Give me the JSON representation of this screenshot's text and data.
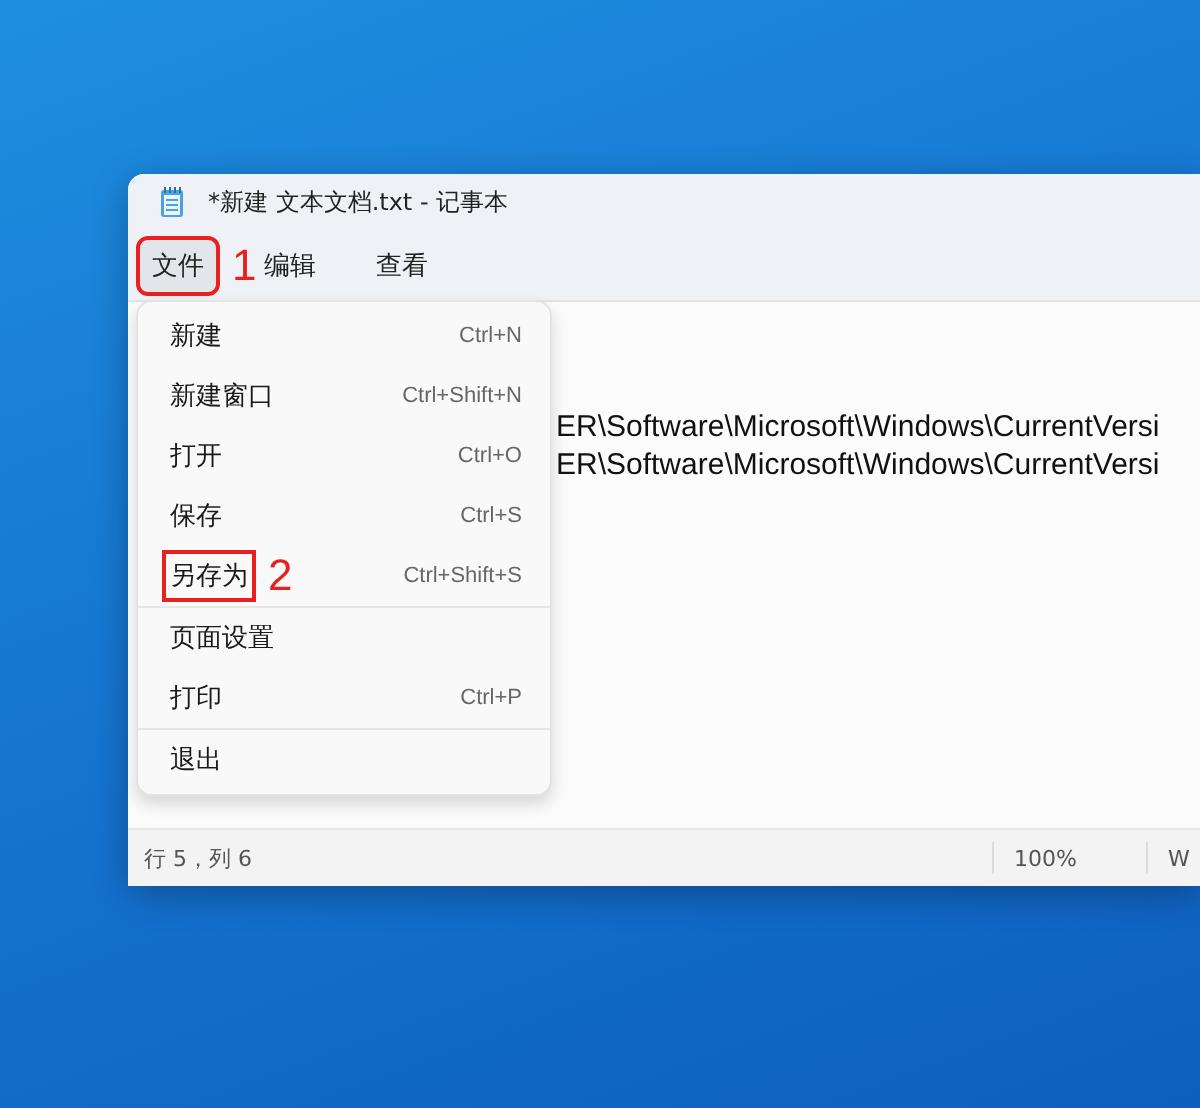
{
  "window": {
    "title": "*新建 文本文档.txt - 记事本"
  },
  "menu_bar": [
    {
      "label": "文件",
      "selected": true,
      "annotation": "1"
    },
    {
      "label": "编辑",
      "selected": false
    },
    {
      "label": "查看",
      "selected": false
    }
  ],
  "file_menu": {
    "groups": [
      [
        {
          "label": "新建",
          "shortcut": "Ctrl+N"
        },
        {
          "label": "新建窗口",
          "shortcut": "Ctrl+Shift+N"
        },
        {
          "label": "打开",
          "shortcut": "Ctrl+O"
        },
        {
          "label": "保存",
          "shortcut": "Ctrl+S"
        },
        {
          "label": "另存为",
          "shortcut": "Ctrl+Shift+S",
          "annotation": "2"
        }
      ],
      [
        {
          "label": "页面设置"
        },
        {
          "label": "打印",
          "shortcut": "Ctrl+P"
        }
      ],
      [
        {
          "label": "退出"
        }
      ]
    ]
  },
  "editor": {
    "lines": [
      "ER\\Software\\Microsoft\\Windows\\CurrentVersi",
      "ER\\Software\\Microsoft\\Windows\\CurrentVersi"
    ]
  },
  "status_bar": {
    "position": "行 5，列 6",
    "zoom": "100%",
    "encoding": "W"
  }
}
